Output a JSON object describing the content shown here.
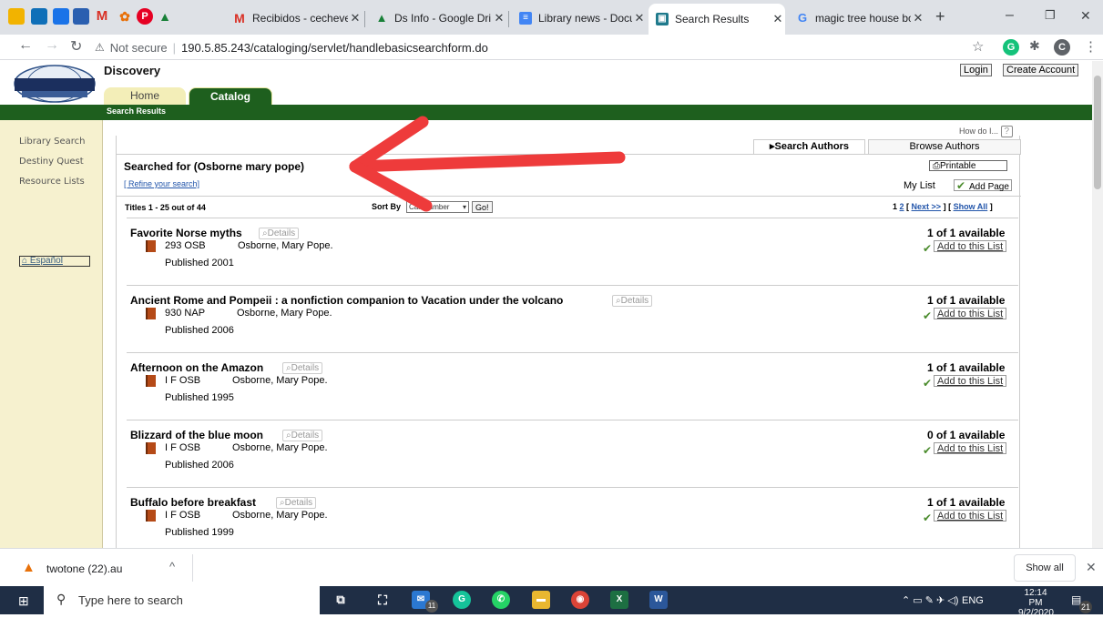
{
  "browser": {
    "tabs": [
      {
        "title": "Recibidos - cecheve",
        "icon": "gmail-icon",
        "active": false
      },
      {
        "title": "Ds Info - Google Dri",
        "icon": "drive-icon",
        "active": false
      },
      {
        "title": "Library news - Docu",
        "icon": "docs-icon",
        "active": false
      },
      {
        "title": "Search Results",
        "icon": "destiny-icon",
        "active": true
      },
      {
        "title": "magic tree house bo",
        "icon": "google-icon",
        "active": false
      }
    ],
    "new_tab": "+",
    "minimize": "–",
    "restore": "❐",
    "close": "✕",
    "not_secure": "Not secure",
    "url": "190.5.85.243/cataloging/servlet/handlebasicsearchform.do"
  },
  "site": {
    "title": "Discovery",
    "login": "Login",
    "create_account": "Create Account",
    "tab_home": "Home",
    "tab_catalog": "Catalog",
    "breadcrumb": "Search Results",
    "sidebar": [
      "Library Search",
      "Destiny Quest",
      "Resource Lists"
    ],
    "espanol": "Español"
  },
  "search": {
    "how_do_i": "How do I...",
    "help": "?",
    "search_authors": "Search Authors",
    "browse_authors": "Browse Authors",
    "searched_for": "Searched for (Osborne mary pope)",
    "refine": "[ Refine your search]",
    "printable": "Printable",
    "my_list": "My List",
    "add_page": "Add Page",
    "titles_count": "Titles 1 - 25 out of 44",
    "sort_by": "Sort By",
    "sort_value": "Call Number",
    "go": "Go!",
    "pages": "1",
    "page2": "2",
    "next": "Next >>",
    "show_all": "Show All"
  },
  "results": [
    {
      "title": "Favorite Norse myths",
      "details": "Details",
      "call": "293 OSB",
      "author": "Osborne, Mary Pope.",
      "published": "Published 2001",
      "availability": "1 of 1 available",
      "add": "Add to this List"
    },
    {
      "title": "Ancient Rome and Pompeii : a nonfiction companion to Vacation under the volcano",
      "details": "Details",
      "call": "930 NAP",
      "author": "Osborne, Mary Pope.",
      "published": "Published 2006",
      "availability": "1 of 1 available",
      "add": "Add to this List"
    },
    {
      "title": "Afternoon on the Amazon",
      "details": "Details",
      "call": "I F OSB",
      "author": "Osborne, Mary Pope.",
      "published": "Published 1995",
      "availability": "1 of 1 available",
      "add": "Add to this List"
    },
    {
      "title": "Blizzard of the blue moon",
      "details": "Details",
      "call": "I F OSB",
      "author": "Osborne, Mary Pope.",
      "published": "Published 2006",
      "availability": "0 of 1 available",
      "add": "Add to this List"
    },
    {
      "title": "Buffalo before breakfast",
      "details": "Details",
      "call": "I F OSB",
      "author": "Osborne, Mary Pope.",
      "published": "Published 1999",
      "availability": "1 of 1 available",
      "add": "Add to this List"
    }
  ],
  "download": {
    "file": "twotone (22).au",
    "show_all": "Show all"
  },
  "taskbar": {
    "search_placeholder": "Type here to search",
    "mail_badge": "11",
    "time": "12:14 PM",
    "date": "9/2/2020",
    "lang": "ENG",
    "notif": "21"
  },
  "colors": {
    "site_green": "#1e5f1e",
    "annotation_arrow": "#ee3b3b"
  }
}
